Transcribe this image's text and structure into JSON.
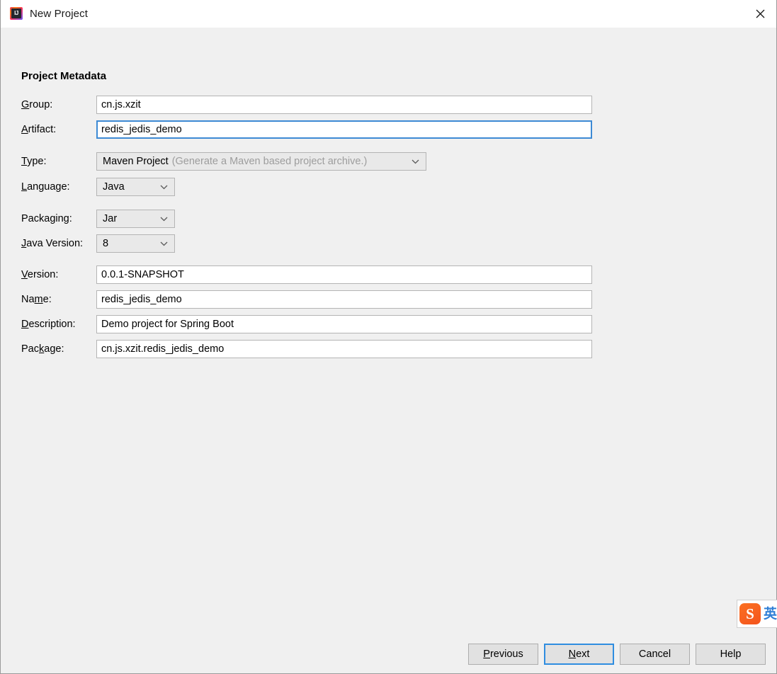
{
  "window": {
    "title": "New Project",
    "app_icon": "intellij-idea-icon",
    "icon_text": "IJ",
    "close_label": "✕"
  },
  "section": {
    "title": "Project Metadata"
  },
  "fields": {
    "group": {
      "label_pre": "",
      "label_mnemonic": "G",
      "label_post": "roup:",
      "value": "cn.js.xzit"
    },
    "artifact": {
      "label_pre": "",
      "label_mnemonic": "A",
      "label_post": "rtifact:",
      "value": "redis_jedis_demo"
    },
    "type": {
      "label_pre": "",
      "label_mnemonic": "T",
      "label_post": "ype:",
      "value": "Maven Project",
      "hint": "(Generate a Maven based project archive.)"
    },
    "language": {
      "label_pre": "",
      "label_mnemonic": "L",
      "label_post": "anguage:",
      "value": "Java"
    },
    "packaging": {
      "label_pre": "Packa",
      "label_mnemonic": "g",
      "label_post": "ing:",
      "value": "Jar"
    },
    "java_version": {
      "label_pre": "",
      "label_mnemonic": "J",
      "label_post": "ava Version:",
      "value": "8"
    },
    "version": {
      "label_pre": "",
      "label_mnemonic": "V",
      "label_post": "ersion:",
      "value": "0.0.1-SNAPSHOT"
    },
    "name": {
      "label_pre": "Na",
      "label_mnemonic": "m",
      "label_post": "e:",
      "value": "redis_jedis_demo"
    },
    "description": {
      "label_pre": "",
      "label_mnemonic": "D",
      "label_post": "escription:",
      "value": "Demo project for Spring Boot"
    },
    "package": {
      "label_pre": "Pac",
      "label_mnemonic": "k",
      "label_post": "age:",
      "value": "cn.js.xzit.redis_jedis_demo"
    }
  },
  "buttons": {
    "previous_pre": "",
    "previous_mnemonic": "P",
    "previous_post": "revious",
    "next_pre": "",
    "next_mnemonic": "N",
    "next_post": "ext",
    "cancel": "Cancel",
    "help": "Help"
  },
  "ime": {
    "logo_text": "S",
    "mode_char": "英"
  },
  "colors": {
    "focus_blue": "#3d8ad4",
    "default_button_blue": "#2f8de0",
    "dialog_bg": "#f0f0f0",
    "field_bg": "#ffffff",
    "combo_bg": "#e9e9e9",
    "hint_gray": "#9d9d9d"
  }
}
